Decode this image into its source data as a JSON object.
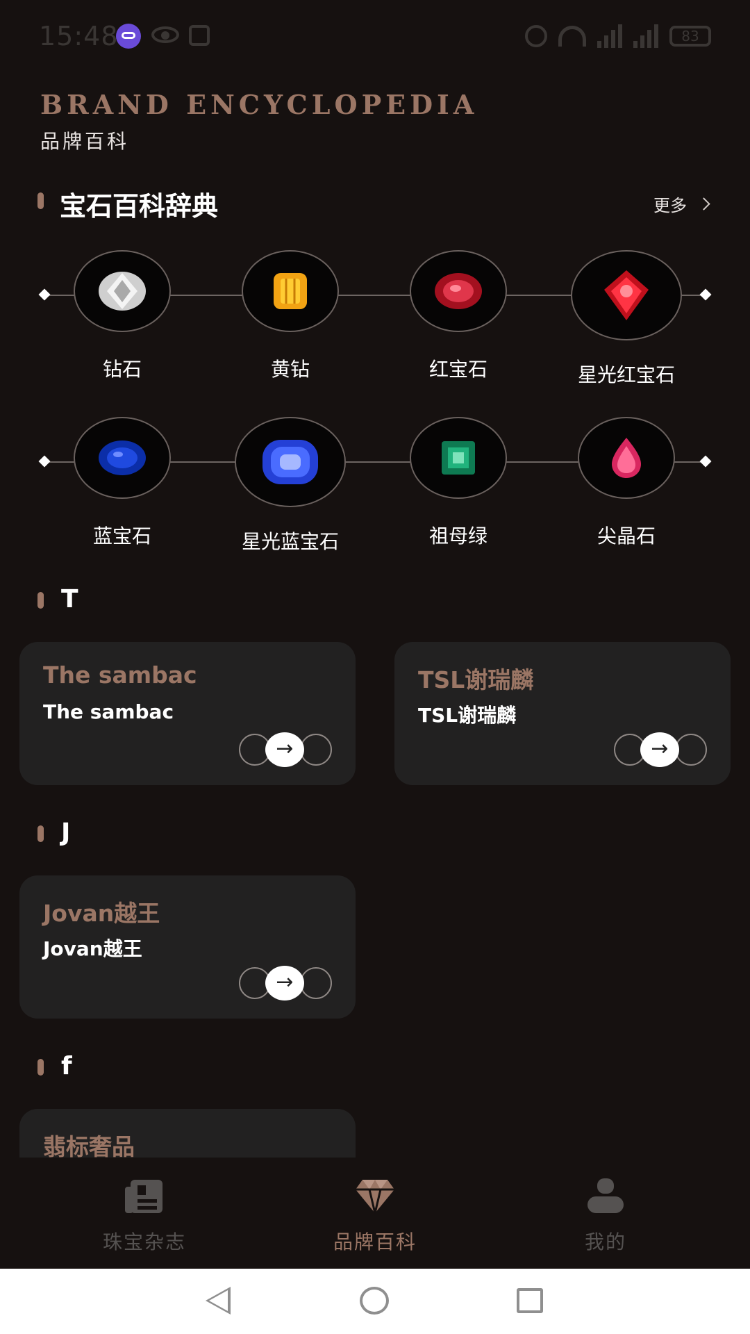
{
  "status_bar": {
    "time": "15:48",
    "battery": "83"
  },
  "header": {
    "title_en": "BRAND ENCYCLOPEDIA",
    "title_cn": "品牌百科"
  },
  "gem_section": {
    "title": "宝石百科辞典",
    "more_label": "更多",
    "row1": [
      {
        "name": "钻石",
        "icon": "diamond-gem-icon",
        "color": "#d8d8d8"
      },
      {
        "name": "黄钻",
        "icon": "yellow-diamond-icon",
        "color": "#f2a313"
      },
      {
        "name": "红宝石",
        "icon": "ruby-icon",
        "color": "#c01a2c"
      },
      {
        "name": "星光红宝石",
        "icon": "star-ruby-icon",
        "color": "#e0202e"
      }
    ],
    "row2": [
      {
        "name": "蓝宝石",
        "icon": "sapphire-icon",
        "color": "#1238b8"
      },
      {
        "name": "星光蓝宝石",
        "icon": "star-sapphire-icon",
        "color": "#2f52e0"
      },
      {
        "name": "祖母绿",
        "icon": "emerald-icon",
        "color": "#159a6a"
      },
      {
        "name": "尖晶石",
        "icon": "spinel-icon",
        "color": "#e23a6c"
      }
    ]
  },
  "brand_groups": [
    {
      "letter": "T",
      "brands": [
        {
          "name": "The sambac",
          "subtitle": "The sambac"
        },
        {
          "name": "TSL谢瑞麟",
          "subtitle": "TSL谢瑞麟"
        }
      ]
    },
    {
      "letter": "J",
      "brands": [
        {
          "name": "Jovan越王",
          "subtitle": "Jovan越王"
        }
      ]
    },
    {
      "letter": "f",
      "brands": [
        {
          "name": "翡标奢品",
          "subtitle": ""
        }
      ]
    }
  ],
  "bottom_nav": {
    "items": [
      {
        "label": "珠宝杂志",
        "icon": "magazine-icon",
        "active": false
      },
      {
        "label": "品牌百科",
        "icon": "diamond-icon",
        "active": true
      },
      {
        "label": "我的",
        "icon": "user-icon",
        "active": false
      }
    ]
  },
  "colors": {
    "background": "#161110",
    "accent": "#9b7665",
    "card": "#222121",
    "text": "#ffffff",
    "inactive": "#555251"
  }
}
